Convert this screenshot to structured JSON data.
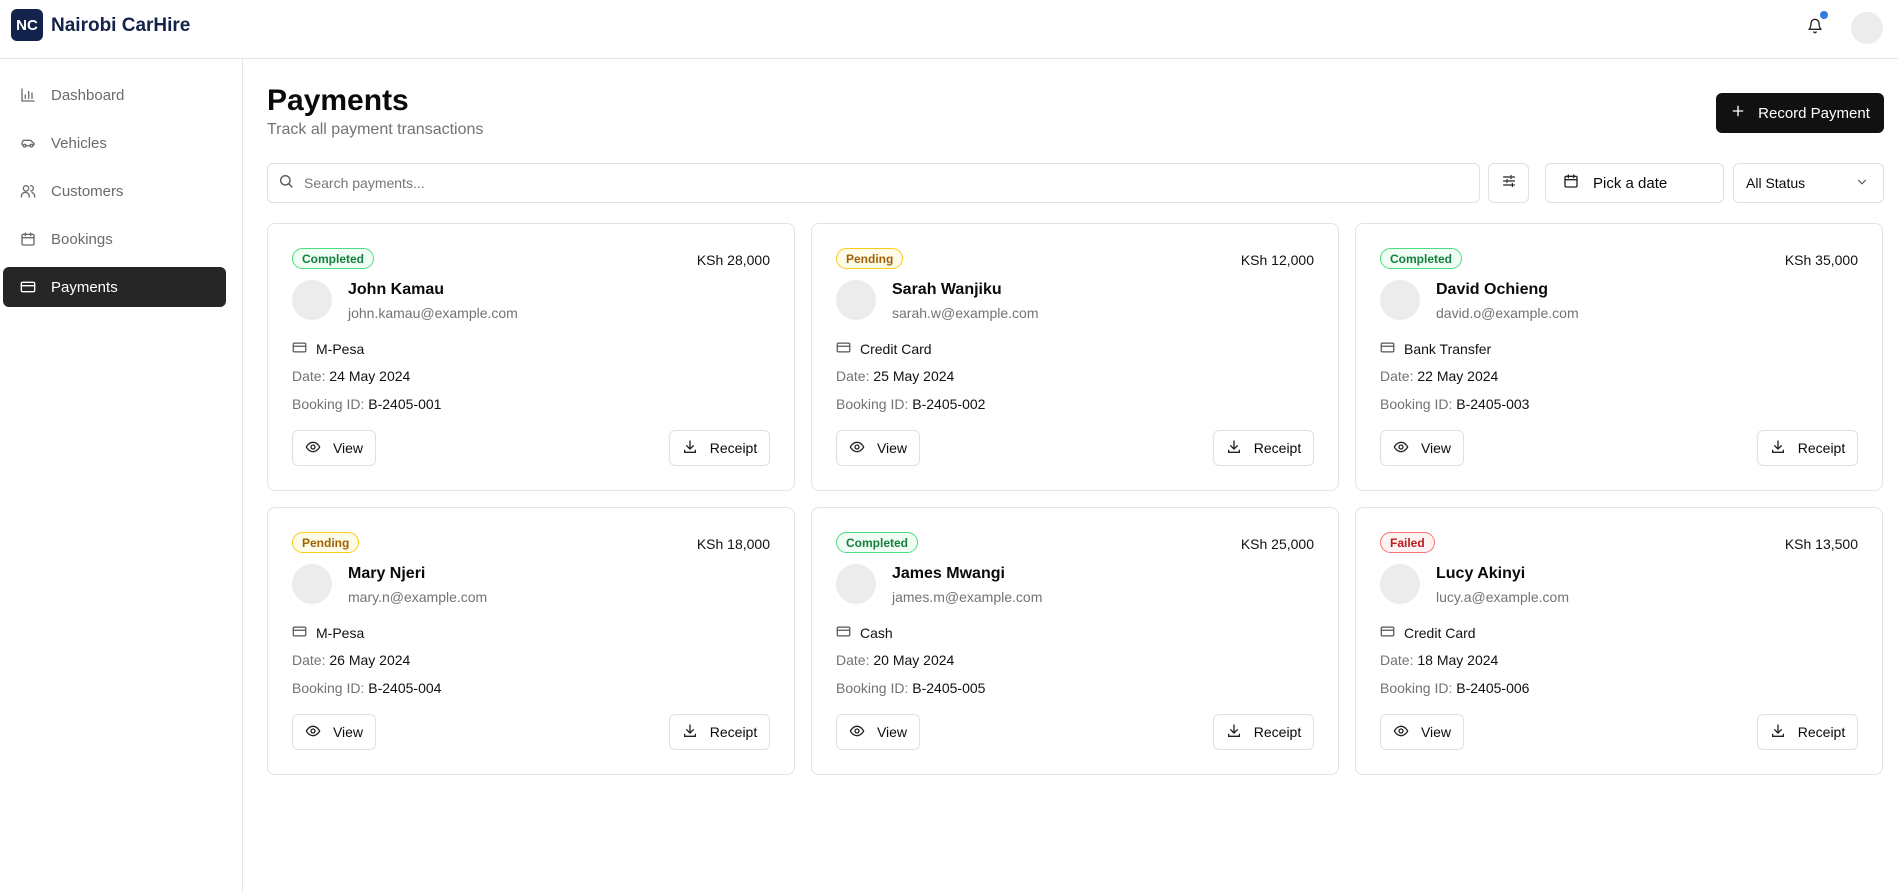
{
  "app": {
    "logo_initials": "NC",
    "title": "Nairobi CarHire"
  },
  "sidebar": {
    "items": [
      {
        "label": "Dashboard",
        "icon": "bar-chart-icon",
        "active": false
      },
      {
        "label": "Vehicles",
        "icon": "car-icon",
        "active": false
      },
      {
        "label": "Customers",
        "icon": "users-icon",
        "active": false
      },
      {
        "label": "Bookings",
        "icon": "calendar-icon",
        "active": false
      },
      {
        "label": "Payments",
        "icon": "credit-card-icon",
        "active": true
      }
    ]
  },
  "header": {
    "title": "Payments",
    "subtitle": "Track all payment transactions",
    "record_button": "Record Payment"
  },
  "filters": {
    "search_placeholder": "Search payments...",
    "date_label": "Pick a date",
    "status_selected": "All Status"
  },
  "labels": {
    "date_prefix": "Date:",
    "booking_prefix": "Booking ID:",
    "view": "View",
    "receipt": "Receipt"
  },
  "payments": [
    {
      "status": "Completed",
      "amount": "KSh 28,000",
      "name": "John Kamau",
      "email": "john.kamau@example.com",
      "method": "M-Pesa",
      "date": "24 May 2024",
      "booking_id": "B-2405-001"
    },
    {
      "status": "Pending",
      "amount": "KSh 12,000",
      "name": "Sarah Wanjiku",
      "email": "sarah.w@example.com",
      "method": "Credit Card",
      "date": "25 May 2024",
      "booking_id": "B-2405-002"
    },
    {
      "status": "Completed",
      "amount": "KSh 35,000",
      "name": "David Ochieng",
      "email": "david.o@example.com",
      "method": "Bank Transfer",
      "date": "22 May 2024",
      "booking_id": "B-2405-003"
    },
    {
      "status": "Pending",
      "amount": "KSh 18,000",
      "name": "Mary Njeri",
      "email": "mary.n@example.com",
      "method": "M-Pesa",
      "date": "26 May 2024",
      "booking_id": "B-2405-004"
    },
    {
      "status": "Completed",
      "amount": "KSh 25,000",
      "name": "James Mwangi",
      "email": "james.m@example.com",
      "method": "Cash",
      "date": "20 May 2024",
      "booking_id": "B-2405-005"
    },
    {
      "status": "Failed",
      "amount": "KSh 13,500",
      "name": "Lucy Akinyi",
      "email": "lucy.a@example.com",
      "method": "Credit Card",
      "date": "18 May 2024",
      "booking_id": "B-2405-006"
    }
  ],
  "colors": {
    "brand": "#14234b",
    "accent_dot": "#2f7de1",
    "active_nav": "#262626",
    "primary_button": "#111111"
  }
}
